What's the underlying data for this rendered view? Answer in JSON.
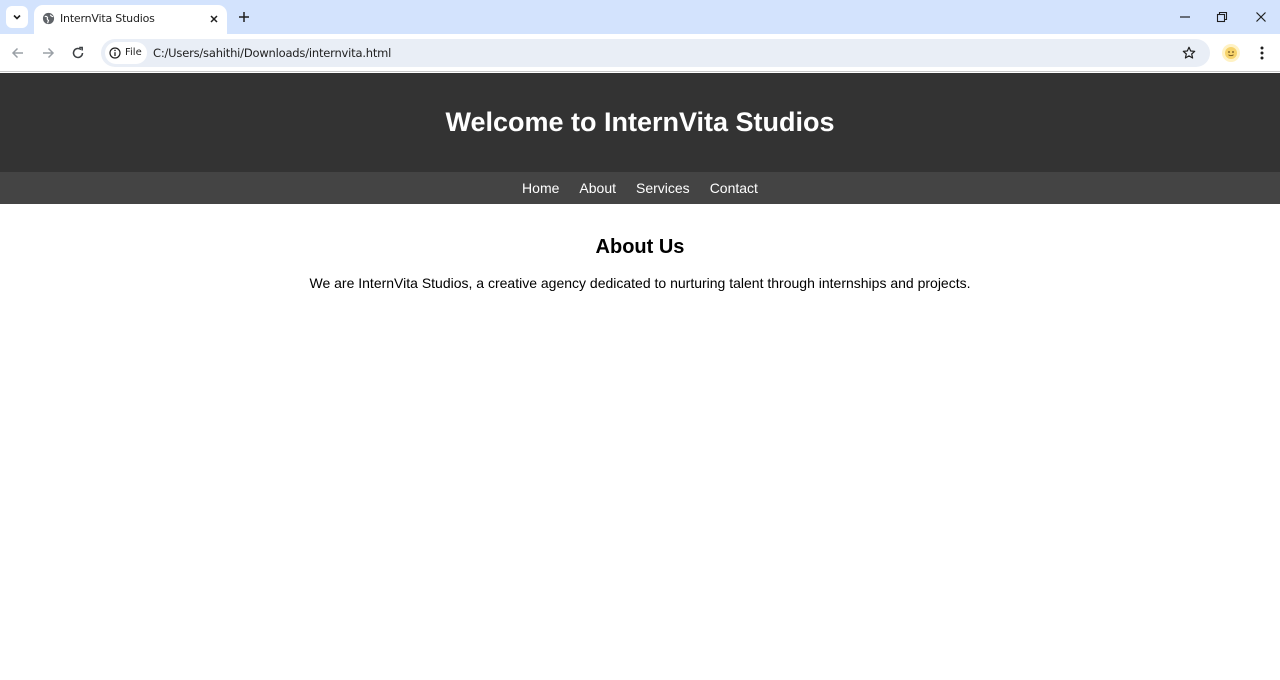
{
  "browser": {
    "tab": {
      "title": "InternVita Studios"
    },
    "address_bar": {
      "chip_label": "File",
      "url": "C:/Users/sahithi/Downloads/internvita.html"
    }
  },
  "site": {
    "header_title": "Welcome to InternVita Studios",
    "nav": [
      {
        "label": "Home"
      },
      {
        "label": "About"
      },
      {
        "label": "Services"
      },
      {
        "label": "Contact"
      }
    ],
    "about": {
      "heading": "About Us",
      "text": "We are InternVita Studios, a creative agency dedicated to nurturing talent through internships and projects."
    }
  },
  "colors": {
    "tabstrip": "#d3e3fd",
    "header_bg": "#333333",
    "nav_bg": "#444444",
    "omnibox_bg": "#e9eef6"
  },
  "icons": [
    "tab-search-icon",
    "globe-icon",
    "close-icon",
    "plus-icon",
    "minimize-icon",
    "restore-icon",
    "window-close-icon",
    "back-icon",
    "forward-icon",
    "reload-icon",
    "info-icon",
    "star-icon",
    "profile-icon",
    "menu-icon"
  ]
}
